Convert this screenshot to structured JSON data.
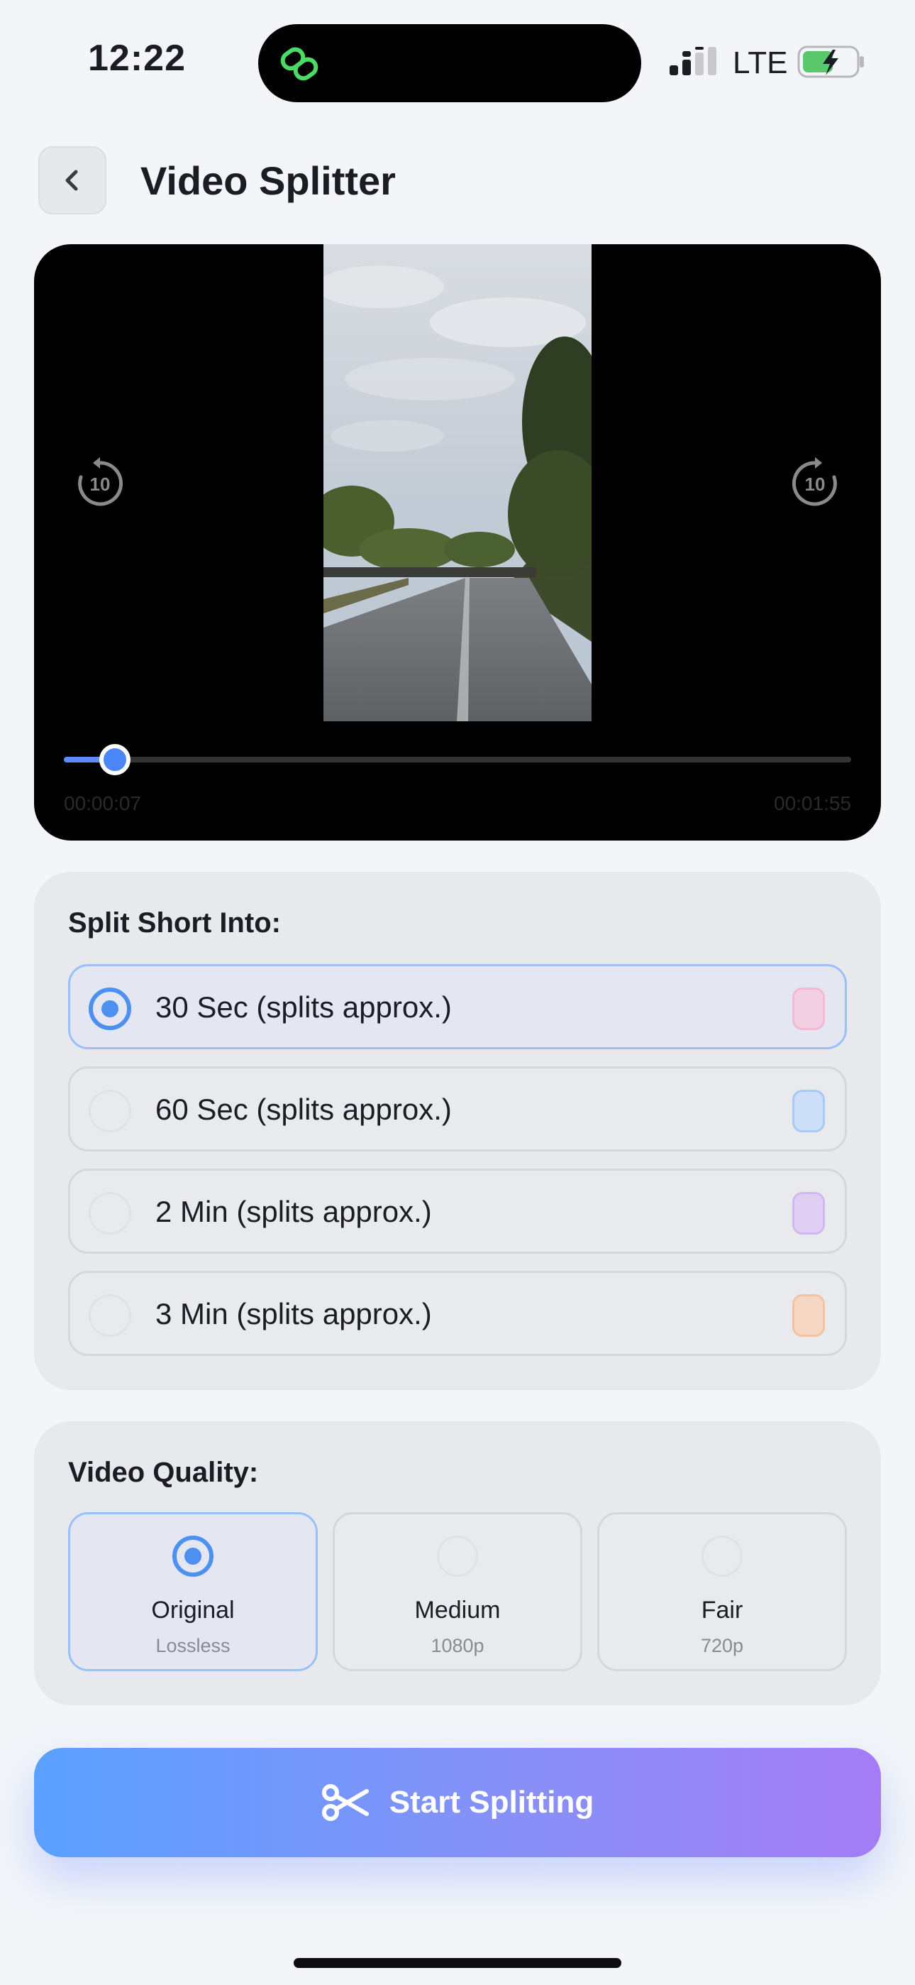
{
  "status": {
    "time": "12:22",
    "network": "LTE"
  },
  "header": {
    "title": "Video Splitter"
  },
  "player": {
    "current_time": "00:00:07",
    "total_time": "00:01:55",
    "progress": 0.065,
    "skip_back": "10",
    "skip_forward": "10"
  },
  "split": {
    "title": "Split Short Into:",
    "options": [
      {
        "label": "30 Sec (splits approx.)",
        "selected": true,
        "color": "#f2b8d6"
      },
      {
        "label": "60 Sec (splits approx.)",
        "selected": false,
        "color": "#a9c8f5"
      },
      {
        "label": "2 Min (splits approx.)",
        "selected": false,
        "color": "#d1b8f0"
      },
      {
        "label": "3 Min (splits approx.)",
        "selected": false,
        "color": "#f3c3a0"
      }
    ]
  },
  "quality": {
    "title": "Video Quality:",
    "options": [
      {
        "label": "Original",
        "sub": "Lossless",
        "selected": true
      },
      {
        "label": "Medium",
        "sub": "1080p",
        "selected": false
      },
      {
        "label": "Fair",
        "sub": "720p",
        "selected": false
      }
    ]
  },
  "cta": {
    "label": "Start Splitting"
  },
  "colors": {
    "accent": "#4d90f0",
    "gradient_start": "#5aa0ff",
    "gradient_end": "#a47cf6",
    "battery_green": "#5ac86a"
  }
}
